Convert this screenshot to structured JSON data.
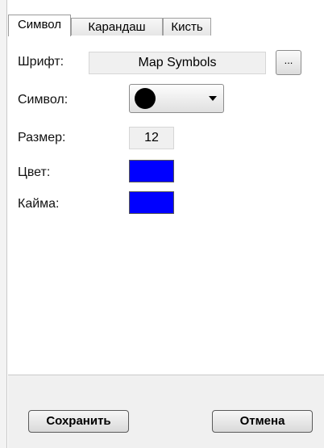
{
  "tabs": [
    {
      "label": "Символ",
      "active": true
    },
    {
      "label": "Карандаш",
      "active": false
    },
    {
      "label": "Кисть",
      "active": false
    }
  ],
  "fields": {
    "font_label": "Шрифт:",
    "font_value": "Map Symbols",
    "font_browse": "...",
    "symbol_label": "Символ:",
    "size_label": "Размер:",
    "size_value": "12",
    "color_label": "Цвет:",
    "border_label": "Кайма:"
  },
  "colors": {
    "symbol_color": "#0000ff",
    "border_color": "#0000ff"
  },
  "buttons": {
    "save": "Сохранить",
    "cancel": "Отмена"
  }
}
